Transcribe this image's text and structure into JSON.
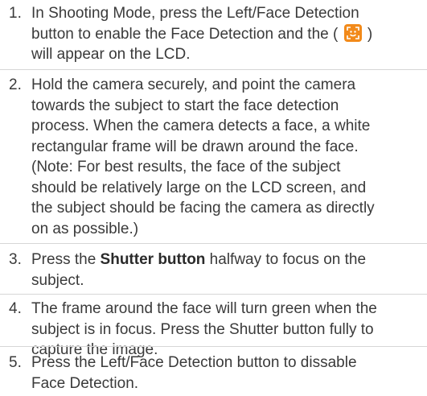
{
  "steps": [
    {
      "number": "1.",
      "lines": [
        {
          "text": "In Shooting Mode, press the Left/Face Detection"
        },
        {
          "text": "button to enable the Face Detection and the (",
          "icon": "face-detection-icon",
          "after": ")"
        },
        {
          "text": "will appear on the LCD."
        }
      ]
    },
    {
      "number": "2.",
      "lines": [
        {
          "text": "Hold the camera securely, and point the camera"
        },
        {
          "text": "towards the subject to start the face detection"
        },
        {
          "text": "process. When the camera detects a face, a white"
        },
        {
          "text": "rectangular frame will be drawn around the face."
        },
        {
          "text": "(Note: For best results, the face of the subject"
        },
        {
          "text": "should be relatively large on the LCD screen, and"
        },
        {
          "text": "the subject should be facing the camera as directly"
        },
        {
          "text": "on as possible.)"
        }
      ]
    },
    {
      "number": "3.",
      "lines": [
        {
          "text": "Press the ",
          "bold": "Shutter button",
          "after": " halfway to focus on the"
        },
        {
          "text": "subject."
        }
      ]
    },
    {
      "number": "4.",
      "lines": [
        {
          "text": "The frame around the face will turn green when the"
        },
        {
          "text": "subject is in focus. Press the Shutter button fully to"
        },
        {
          "text": "capture the image."
        }
      ]
    },
    {
      "number": "5.",
      "lines": [
        {
          "text": "Press the Left/Face Detection button to dissable"
        },
        {
          "text": "Face Detection."
        }
      ]
    }
  ],
  "icon_colors": {
    "face_detection_bg": "#f28a1a",
    "face_detection_fg": "#ffffff"
  }
}
